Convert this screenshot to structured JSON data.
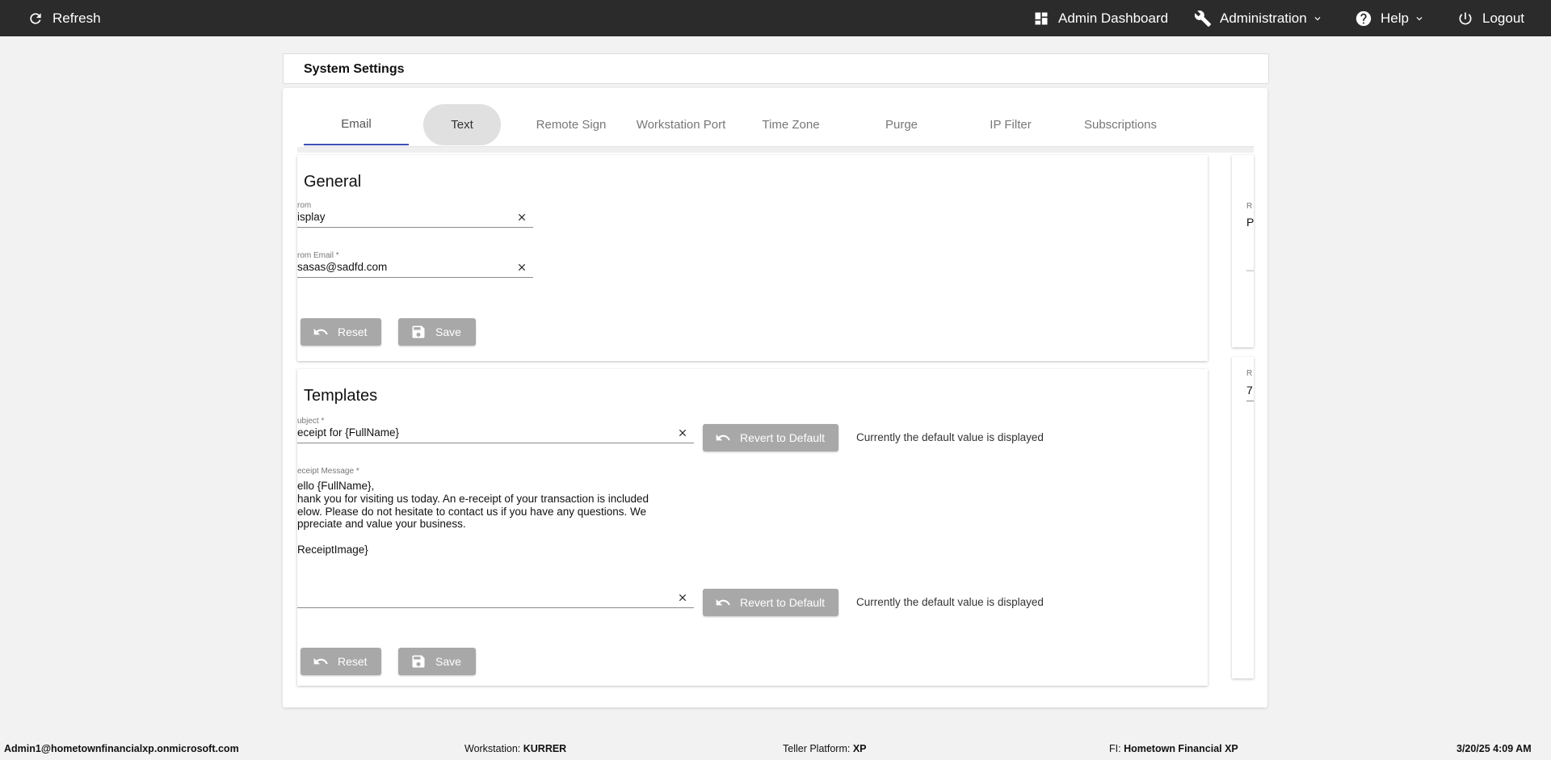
{
  "topbar": {
    "refresh_label": "Refresh",
    "admin_dashboard_label": "Admin Dashboard",
    "administration_label": "Administration",
    "help_label": "Help",
    "logout_label": "Logout"
  },
  "page": {
    "title": "System Settings"
  },
  "tabs": [
    {
      "label": "Email"
    },
    {
      "label": "Text"
    },
    {
      "label": "Remote Sign"
    },
    {
      "label": "Workstation Port"
    },
    {
      "label": "Time Zone"
    },
    {
      "label": "Purge"
    },
    {
      "label": "IP Filter"
    },
    {
      "label": "Subscriptions"
    }
  ],
  "general": {
    "title": "General",
    "from_label": "rom",
    "from_value": "isplay",
    "from_email_label": "rom Email *",
    "from_email_value": "sasas@sadfd.com",
    "reset_label": "Reset",
    "save_label": "Save"
  },
  "templates": {
    "title": "Templates",
    "subject_label": "ubject *",
    "subject_value": "eceipt for {FullName}",
    "revert_label": "Revert to Default",
    "default_hint": "Currently the default value is displayed",
    "message_label": "eceipt Message *",
    "message_lines": [
      "ello {FullName},",
      "hank you for visiting us today. An e-receipt of your transaction is included",
      "elow. Please do not hesitate to contact us if you have any questions. We",
      "ppreciate and value your business.",
      "",
      "ReceiptImage}"
    ],
    "third_value": "",
    "reset_label": "Reset",
    "save_label": "Save"
  },
  "side_panel": {
    "top_label": "R",
    "top_value": "P",
    "top_dash": "—",
    "bottom_label": "R",
    "bottom_value": "7"
  },
  "footer": {
    "user": "Admin1@hometownfinancialxp.onmicrosoft.com",
    "workstation_label": "Workstation:",
    "workstation_value": "KURRER",
    "teller_label": "Teller Platform:",
    "teller_value": "XP",
    "fi_label": "FI:",
    "fi_value": "Hometown Financial XP",
    "datetime": "3/20/25 4:09 AM"
  }
}
